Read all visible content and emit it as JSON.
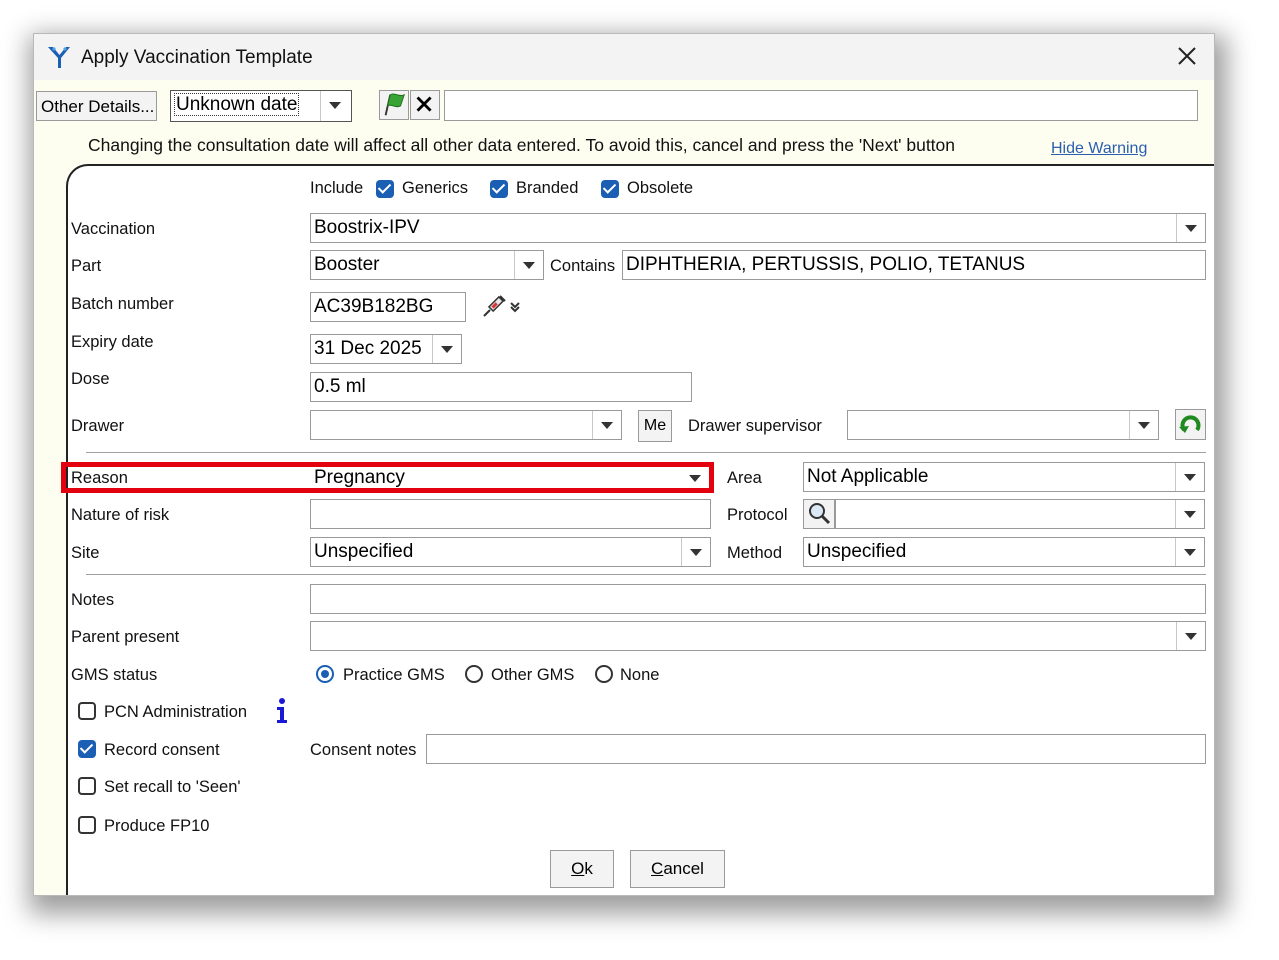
{
  "window": {
    "title": "Apply Vaccination Template"
  },
  "toolbar": {
    "other_details_label": "Other Details...",
    "date_value": "Unknown date",
    "free_text": ""
  },
  "warning": {
    "text": "Changing the consultation date will affect all other data entered. To avoid this, cancel and press the 'Next' button",
    "hide_label": "Hide Warning"
  },
  "include": {
    "label": "Include",
    "generics": "Generics",
    "branded": "Branded",
    "obsolete": "Obsolete"
  },
  "form": {
    "vaccination": {
      "label": "Vaccination",
      "value": "Boostrix-IPV"
    },
    "part": {
      "label": "Part",
      "value": "Booster"
    },
    "contains": {
      "label": "Contains",
      "value": "DIPHTHERIA, PERTUSSIS, POLIO, TETANUS"
    },
    "batch_number": {
      "label": "Batch number",
      "value": "AC39B182BG"
    },
    "expiry_date": {
      "label": "Expiry date",
      "value": "31 Dec 2025"
    },
    "dose": {
      "label": "Dose",
      "value": "0.5 ml"
    },
    "drawer": {
      "label": "Drawer",
      "value": "",
      "me_label": "Me"
    },
    "drawer_supervisor": {
      "label": "Drawer supervisor",
      "value": ""
    },
    "reason": {
      "label": "Reason",
      "value": "Pregnancy"
    },
    "area": {
      "label": "Area",
      "value": "Not Applicable"
    },
    "nature_of_risk": {
      "label": "Nature of risk",
      "value": ""
    },
    "protocol": {
      "label": "Protocol",
      "value": ""
    },
    "site": {
      "label": "Site",
      "value": "Unspecified"
    },
    "method": {
      "label": "Method",
      "value": "Unspecified"
    },
    "notes": {
      "label": "Notes",
      "value": ""
    },
    "parent_present": {
      "label": "Parent present",
      "value": ""
    },
    "gms_status": {
      "label": "GMS status",
      "options": [
        "Practice GMS",
        "Other GMS",
        "None"
      ],
      "selected": "Practice GMS"
    },
    "pcn_administration": {
      "label": "PCN Administration",
      "checked": false
    },
    "record_consent": {
      "label": "Record consent",
      "checked": true
    },
    "consent_notes": {
      "label": "Consent notes",
      "value": ""
    },
    "set_recall": {
      "label": "Set recall to 'Seen'",
      "checked": false
    },
    "produce_fp10": {
      "label": "Produce FP10",
      "checked": false
    }
  },
  "buttons": {
    "ok_underline": "O",
    "ok_rest": "k",
    "cancel_underline": "C",
    "cancel_rest": "ancel"
  },
  "colors": {
    "accent": "#1a5fb4",
    "highlight": "#e3000f",
    "dialog_bg": "#fdfdf0",
    "link": "#2b5fb0"
  }
}
